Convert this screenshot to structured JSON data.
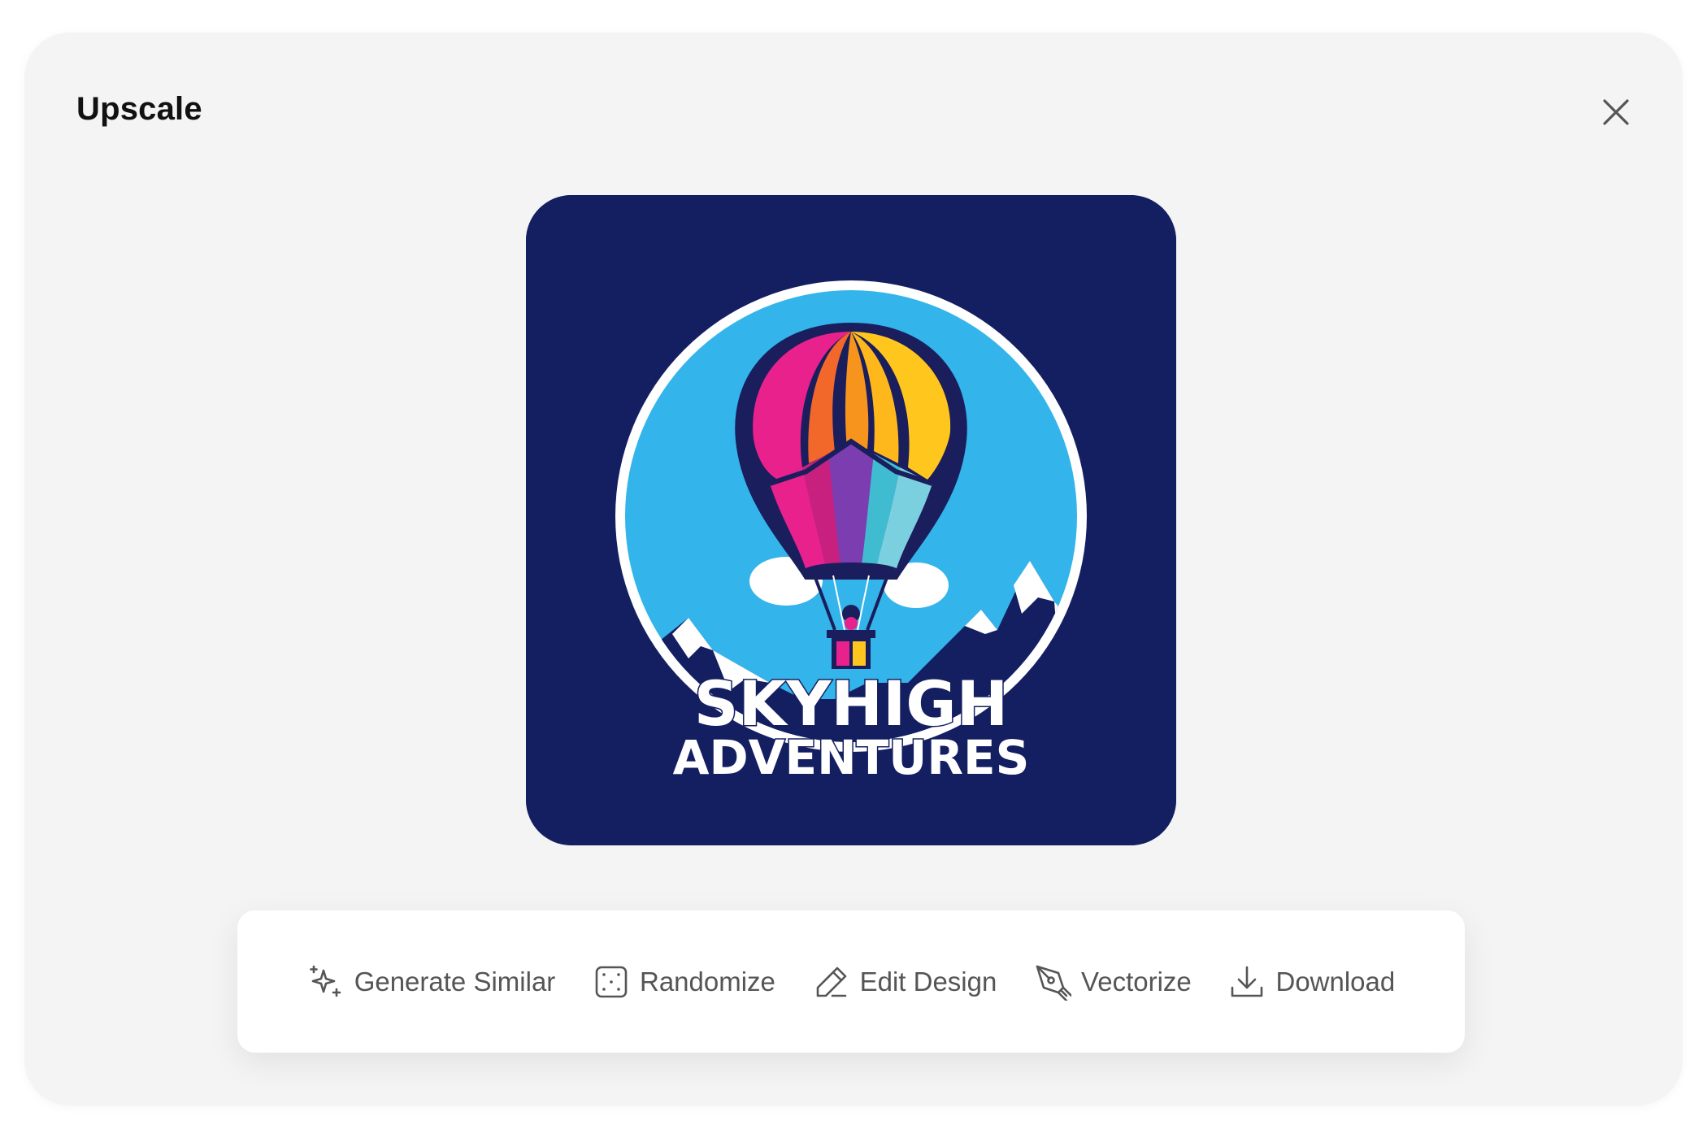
{
  "dialog": {
    "title": "Upscale",
    "close_icon": "close-icon"
  },
  "preview": {
    "logo_text_line1": "SKYHIGH",
    "logo_text_line2": "ADVENTURES",
    "colors": {
      "background": "#141f61",
      "sky": "#33b4ea",
      "ring": "#ffffff"
    }
  },
  "toolbar": {
    "items": [
      {
        "label": "Generate Similar",
        "icon": "sparkles-icon"
      },
      {
        "label": "Randomize",
        "icon": "dice-icon"
      },
      {
        "label": "Edit Design",
        "icon": "pencil-icon"
      },
      {
        "label": "Vectorize",
        "icon": "pen-tool-icon"
      },
      {
        "label": "Download",
        "icon": "download-icon"
      }
    ]
  }
}
